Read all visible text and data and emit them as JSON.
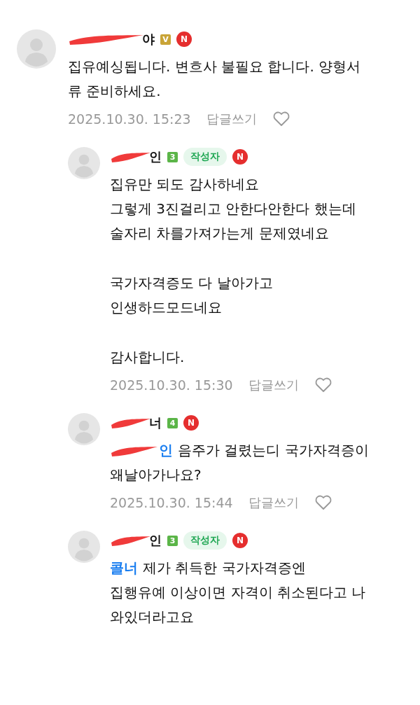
{
  "comments": [
    {
      "reply": false,
      "name_visible": "야",
      "name_redacted": true,
      "level_badge": {
        "text": "V",
        "color": "#c9a437"
      },
      "new_badge": "N",
      "paragraphs": [
        [
          "집유예싱됩니다. 변흐사 불필요 합니다. 양형서",
          "류 준비하세요."
        ]
      ],
      "date": "2025.10.30. 15:23",
      "reply_link": "답글쓰기",
      "liked": false
    },
    {
      "reply": true,
      "name_visible": "인",
      "name_redacted": true,
      "level_badge": {
        "text": "3",
        "color": "#5bb548"
      },
      "author_tag": "작성자",
      "new_badge": "N",
      "paragraphs": [
        [
          "집유만 되도 감사하네요",
          "그렇게 3진걸리고 안한다안한다 했는데",
          "술자리 차를가져가는게 문제였네요"
        ],
        [
          "국가자격증도 다 날아가고",
          "인생하드모드네요"
        ],
        [
          "감사합니다."
        ]
      ],
      "date": "2025.10.30. 15:30",
      "reply_link": "답글쓰기",
      "liked": false
    },
    {
      "reply": true,
      "name_visible": "너",
      "name_redacted": true,
      "level_badge": {
        "text": "4",
        "color": "#5bb548"
      },
      "new_badge": "N",
      "mention": {
        "text": "인",
        "redacted": true
      },
      "paragraphs": [
        [
          "음주가 걸렸는디 국가자격증이",
          "왜날아가나요?"
        ]
      ],
      "date": "2025.10.30. 15:44",
      "reply_link": "답글쓰기",
      "liked": false
    },
    {
      "reply": true,
      "name_visible": "인",
      "name_redacted": true,
      "level_badge": {
        "text": "3",
        "color": "#5bb548"
      },
      "author_tag": "작성자",
      "new_badge": "N",
      "mention": {
        "text": "콜너",
        "redacted": false
      },
      "paragraphs": [
        [
          "제가 취득한 국가자격증엔",
          "집행유예 이상이면 자격이 취소된다고 나",
          "와있더라고요"
        ]
      ]
    }
  ]
}
